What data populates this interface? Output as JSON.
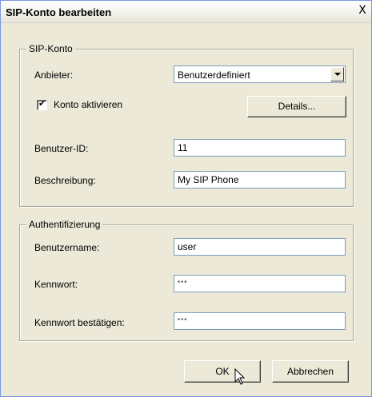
{
  "window": {
    "title": "SIP-Konto bearbeiten",
    "close_glyph": "X"
  },
  "sip_account": {
    "group_title": "SIP-Konto",
    "provider_label": "Anbieter:",
    "provider_value": "Benutzerdefiniert",
    "activate_label": "Konto aktivieren",
    "activate_checked": true,
    "details_button": "Details...",
    "user_id_label": "Benutzer-ID:",
    "user_id_value": "11",
    "description_label": "Beschreibung:",
    "description_value": "My SIP Phone"
  },
  "auth": {
    "group_title": "Authentifizierung",
    "username_label": "Benutzername:",
    "username_value": "user",
    "password_label": "Kennwort:",
    "password_value": "***",
    "confirm_label": "Kennwort bestätigen:",
    "confirm_value": "***"
  },
  "buttons": {
    "ok": "OK",
    "cancel": "Abbrechen"
  }
}
